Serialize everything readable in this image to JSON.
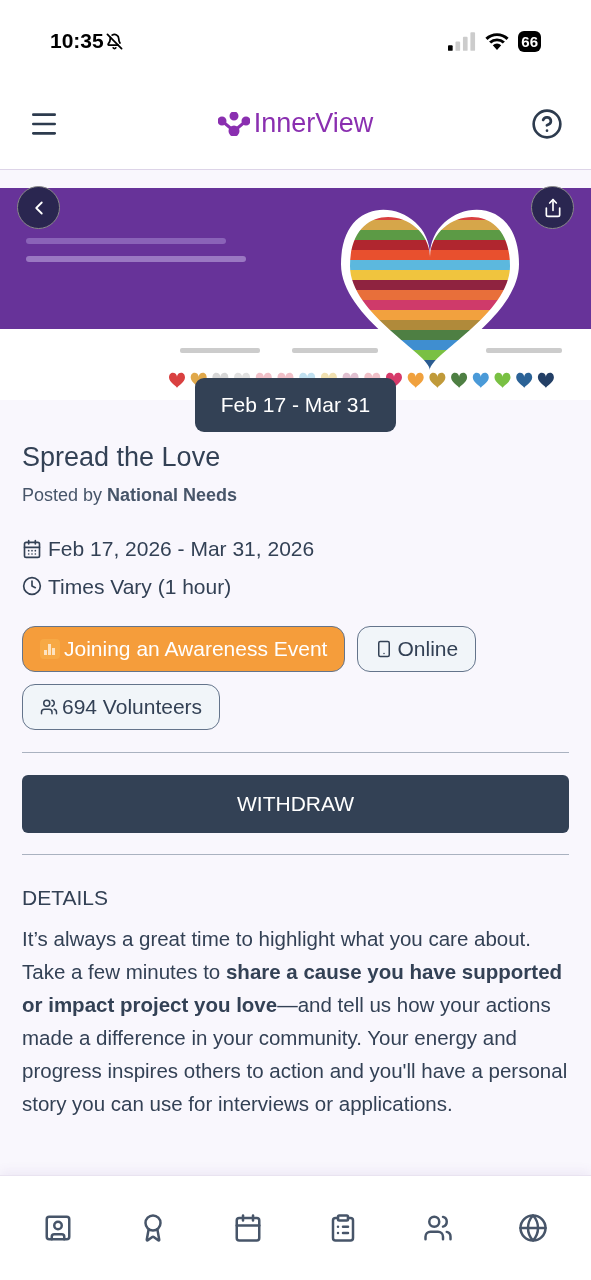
{
  "status_bar": {
    "time": "10:35",
    "battery": "66"
  },
  "header": {
    "brand": "InnerView"
  },
  "banner": {
    "kind": "picture",
    "date_badge": "Feb 17 - Mar 31"
  },
  "event": {
    "title": "Spread the Love",
    "posted_by_label": "Posted by",
    "posted_by": "National Needs",
    "dates": "Feb 17, 2026 - Mar 31, 2026",
    "time": "Times Vary (1 hour)"
  },
  "tags": [
    {
      "kind": "category",
      "label": "Joining an Awareness Event"
    },
    {
      "kind": "online",
      "label": "Online"
    },
    {
      "kind": "volunteers",
      "label": "694 Volunteers"
    }
  ],
  "action_button": "WITHDRAW",
  "details": {
    "heading": "DETAILS",
    "text": "It’s always a great time to highlight what you care about. Take a few minutes to **share a cause you have supported or impact project you love**—and tell us how your actions made a difference in your community. Your energy and progress inspires others to action and you'll have a personal story you can use for interviews or applications."
  },
  "bottom_nav": [
    {
      "kind": "profile",
      "selected": false
    },
    {
      "kind": "awards",
      "selected": false
    },
    {
      "kind": "calendar",
      "selected": false
    },
    {
      "kind": "clipboard",
      "selected": false
    },
    {
      "kind": "community",
      "selected": false
    },
    {
      "kind": "globe",
      "selected": false
    }
  ]
}
